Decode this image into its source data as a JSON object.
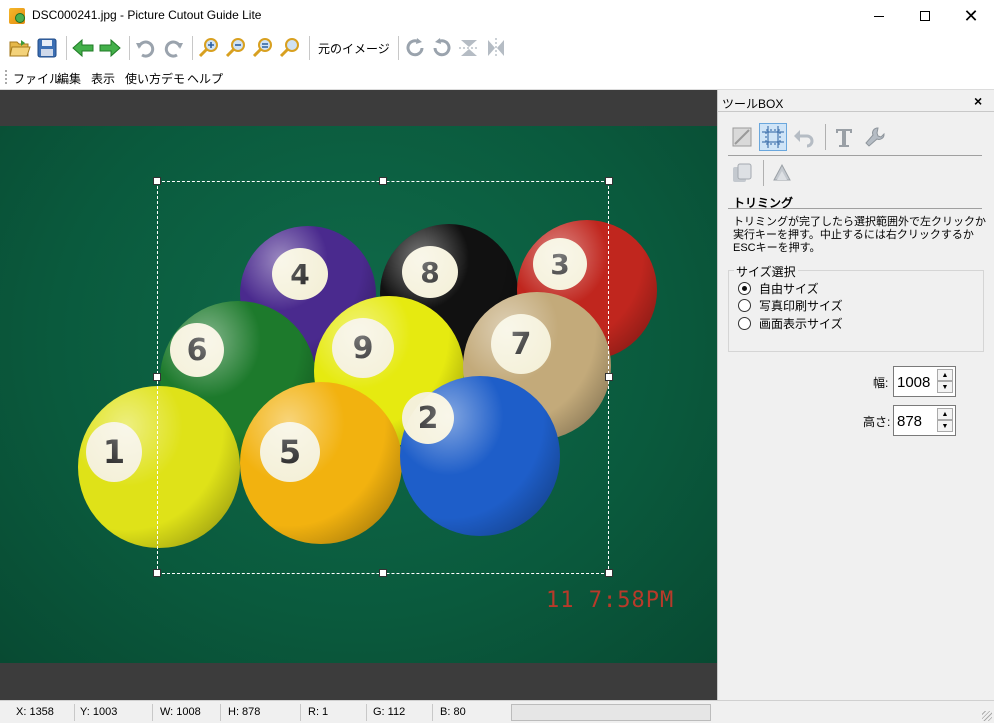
{
  "window": {
    "title": "DSC000241.jpg - Picture Cutout Guide Lite",
    "app_icon": "picture-cutout-app-icon"
  },
  "toolbar": {
    "original_image_label": "元のイメージ",
    "icons": [
      "open-folder-icon",
      "save-icon",
      "back-arrow-icon",
      "forward-arrow-icon",
      "undo-icon",
      "redo-icon",
      "zoom-in-icon",
      "zoom-out-icon",
      "zoom-fit-icon",
      "zoom-actual-icon",
      "rotate-right-icon",
      "rotate-left-icon",
      "flip-vertical-icon",
      "flip-horizontal-icon"
    ]
  },
  "menu": {
    "items": [
      "ファイル",
      "編集",
      "表示",
      "使い方デモ",
      "ヘルプ"
    ]
  },
  "photo": {
    "timestamp": "11   7:58PM",
    "balls": [
      "4",
      "8",
      "3",
      "6",
      "9",
      "7",
      "1",
      "5",
      "2"
    ]
  },
  "toolbox": {
    "title": "ツールBOX",
    "close": "×",
    "section_title": "トリミング",
    "description": "トリミングが完了したら選択範囲外で左クリックか実行キーを押す。中止するには右クリックするかESCキーを押す。",
    "size_group": {
      "legend": "サイズ選択",
      "options": [
        {
          "label": "自由サイズ",
          "selected": true
        },
        {
          "label": "写真印刷サイズ",
          "selected": false
        },
        {
          "label": "画面表示サイズ",
          "selected": false
        }
      ]
    },
    "width_label": "幅:",
    "width_value": "1008",
    "height_label": "高さ:",
    "height_value": "878"
  },
  "status": {
    "x": "X: 1358",
    "y": "Y: 1003",
    "w": "W: 1008",
    "h": "H: 878",
    "r": "R: 1",
    "g": "G: 112",
    "b": "B: 80"
  },
  "colors": {
    "felt_green": "#0a5a3d",
    "canvas_bg": "#3c3c3c",
    "accent_blue": "#6aa7dd"
  }
}
